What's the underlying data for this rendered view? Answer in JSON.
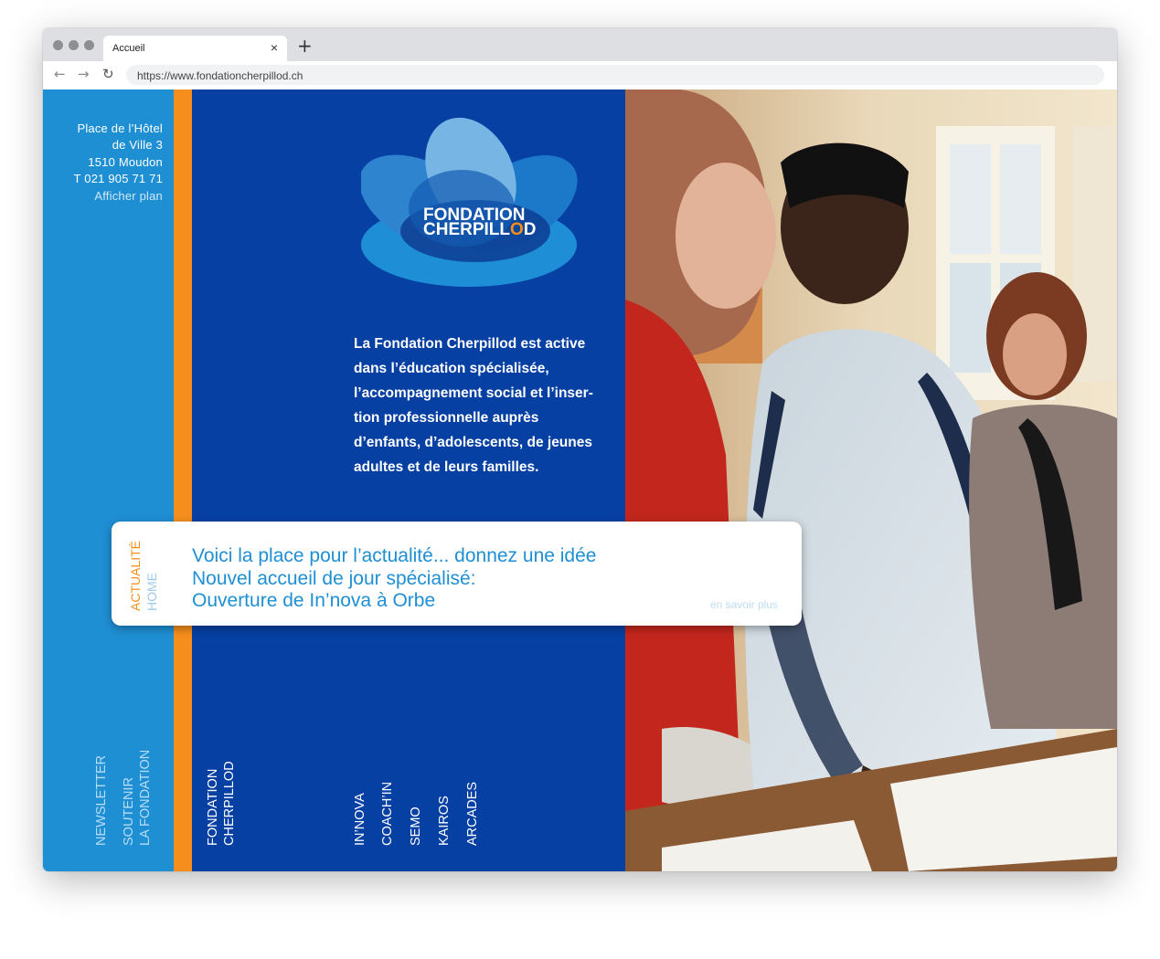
{
  "browser": {
    "tab_title": "Accueil",
    "tab_close": "×",
    "new_tab": "+",
    "back": "←",
    "forward": "→",
    "reload": "↻",
    "url": "https://www.fondationcherpillod.ch"
  },
  "address": {
    "line1": "Place de l’Hôtel",
    "line2": "de Ville 3",
    "line3": "1510 Moudon",
    "phone": "T 021 905 71 71",
    "map_link": "Afficher plan"
  },
  "logo": {
    "line1": "FONDATION",
    "line2_part1": "CHERPILL",
    "line2_o": "O",
    "line2_part2": "D"
  },
  "intro": {
    "lines": [
      "La Fondation Cherpillod est active",
      "dans l’éducation spécialisée,",
      "l’accompagnement social et l’inser-",
      "tion professionnelle auprès",
      "d’enfants, d’adolescents, de jeunes",
      "adultes et de leurs familles."
    ]
  },
  "news": {
    "tab_actualite": "ACTUALITÉ",
    "tab_home": "HOME",
    "lines": [
      "Voici la place pour l’actualité... donnez une idée",
      "Nouvel accueil de jour spécialisé:",
      "Ouverture de In’nova à Orbe"
    ],
    "more": "en savoir plus"
  },
  "nav_left": [
    "NEWSLETTER",
    "SOUTENIR",
    "LA FONDATION"
  ],
  "nav_fondation": [
    "FONDATION",
    "CHERPILLOD"
  ],
  "nav_sites": [
    "IN’NOVA",
    "COACH’IN",
    "SEMO",
    "KAIROS",
    "ARCADES"
  ],
  "colors": {
    "light_blue": "#1f8fd4",
    "orange": "#f58e1c",
    "dark_blue": "#0640a3"
  }
}
